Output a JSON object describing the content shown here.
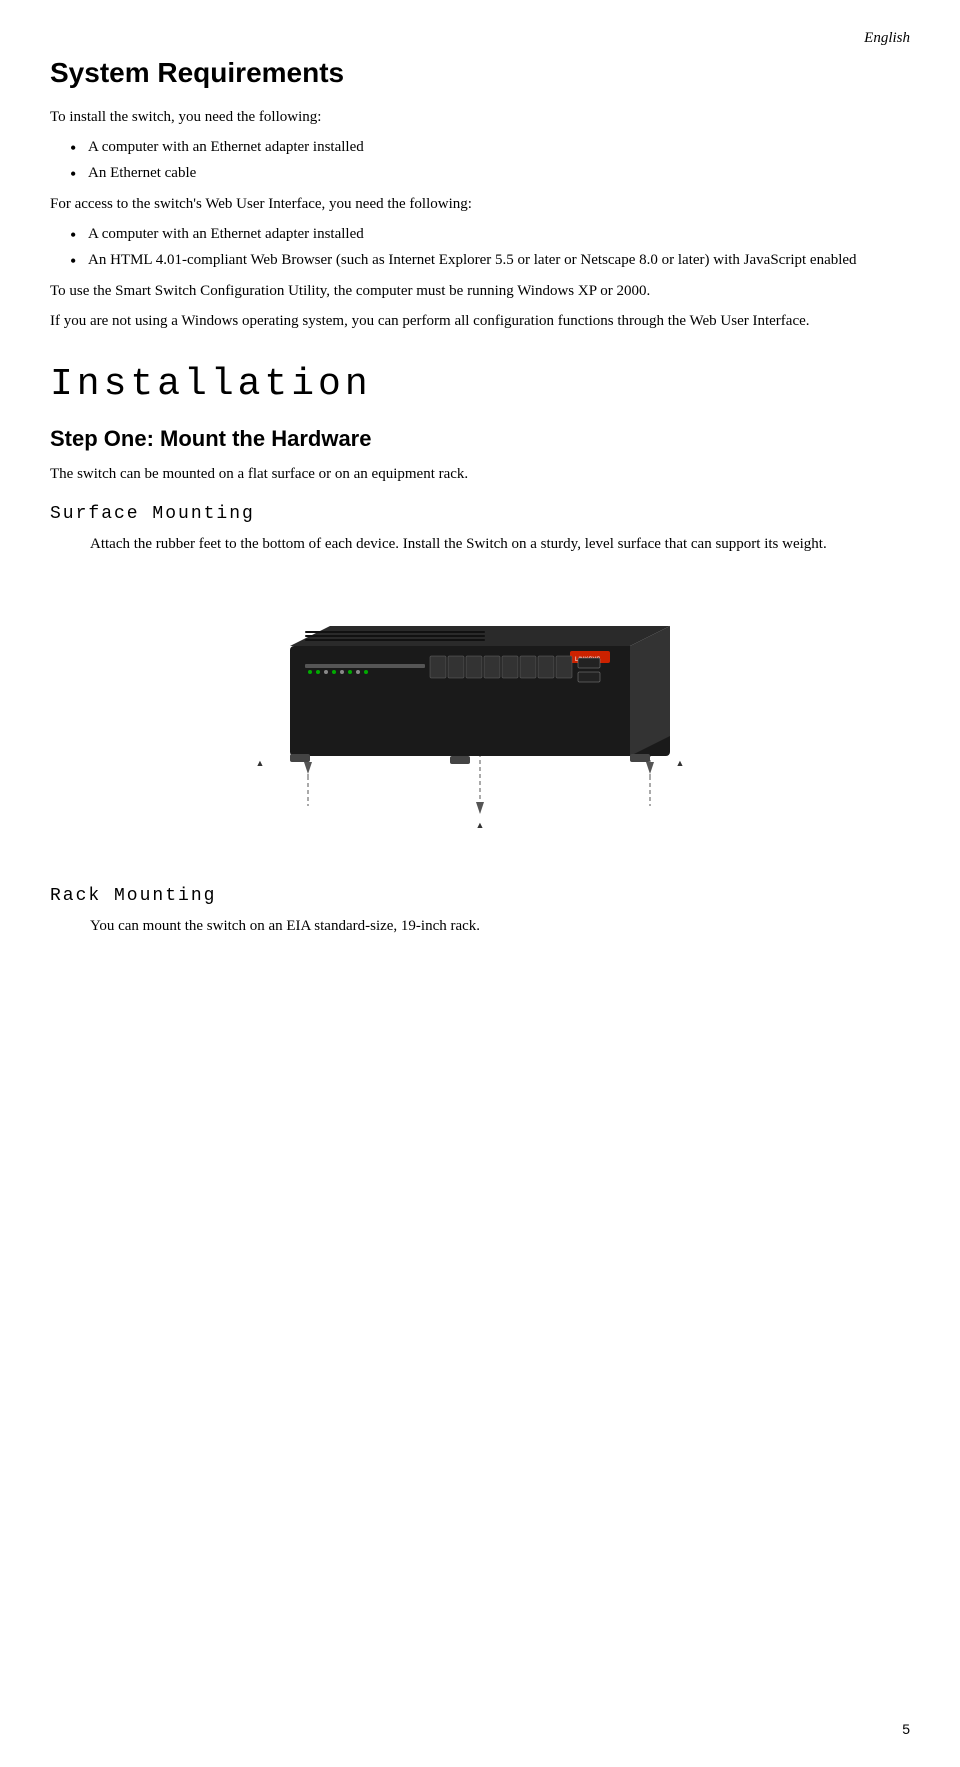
{
  "header": {
    "language": "English"
  },
  "system_requirements": {
    "title": "System Requirements",
    "intro": "To install the switch, you need the following:",
    "bullets_1": [
      "A computer with an Ethernet adapter installed",
      "An Ethernet cable"
    ],
    "access_intro": "For access to the switch's Web User Interface, you need the following:",
    "bullets_2": [
      "A computer with an Ethernet adapter installed",
      "An HTML 4.01-compliant Web Browser (such as Internet Explorer 5.5 or later or Netscape 8.0 or later) with JavaScript enabled"
    ],
    "para1": "To use the Smart Switch Configuration Utility, the computer must be running Windows XP or 2000.",
    "para2": "If you are not using a Windows operating system, you can perform all configuration functions through the Web User Interface."
  },
  "installation": {
    "title": "Installation",
    "step_one": {
      "title": "Step One: Mount the Hardware",
      "intro": "The switch can be mounted on a flat surface or on an equipment rack."
    },
    "surface_mounting": {
      "title": "Surface Mounting",
      "text": "Attach the rubber feet to the bottom of each device. Install the Switch on a sturdy, level surface that can support its weight."
    },
    "rack_mounting": {
      "title": "Rack Mounting",
      "text": "You can mount the switch on an EIA standard-size, 19-inch rack."
    }
  },
  "page": {
    "number": "5"
  }
}
